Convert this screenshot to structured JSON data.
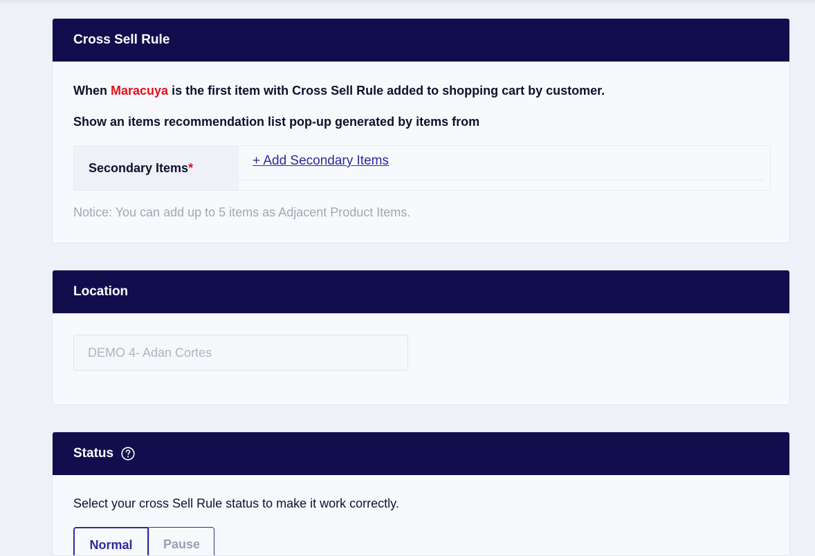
{
  "cross_sell": {
    "title": "Cross Sell Rule",
    "when_prefix": "When ",
    "item_name": "Maracuya",
    "when_suffix": " is the first item with Cross Sell Rule added to shopping cart by customer.",
    "show_line": "Show an items recommendation list pop-up generated by items from",
    "secondary_label": "Secondary Items",
    "required_mark": "*",
    "add_link": "+ Add Secondary Items",
    "notice": "Notice: You can add up to 5 items as Adjacent Product Items."
  },
  "location": {
    "title": "Location",
    "placeholder": "DEMO 4- Adan Cortes"
  },
  "status": {
    "title": "Status",
    "help_icon": "question-circle-icon",
    "description": "Select your cross Sell Rule status to make it work correctly.",
    "options": [
      "Normal",
      "Pause"
    ],
    "selected": "Normal"
  },
  "colors": {
    "header_bg": "#120e4d",
    "highlight": "#e4101a",
    "link": "#2c2a9e"
  }
}
